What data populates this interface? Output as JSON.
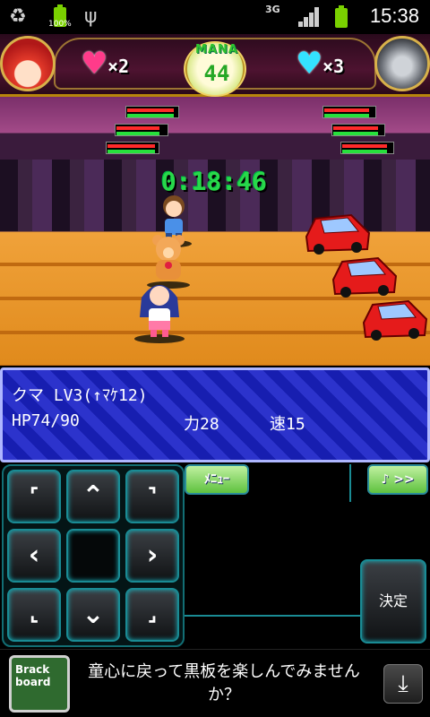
{
  "status_bar": {
    "battery_percent": "100%",
    "network": "3G",
    "time": "15:38",
    "icons": [
      "recycle-icon",
      "battery-charging-icon",
      "usb-icon",
      "network-3g-icon",
      "signal-icon",
      "battery-icon"
    ]
  },
  "hud": {
    "player_lives": "×2",
    "enemy_lives": "×3",
    "mana_label": "MANA",
    "mana_value": "44",
    "timer": "0:18:46",
    "colors": {
      "pink_heart": "#ff3b8a",
      "cyan_heart": "#34e2ff",
      "timer": "#28d84a"
    }
  },
  "gauges": [
    {
      "hp": 0.92,
      "mp": 0.92
    },
    {
      "hp": 0.85,
      "mp": 0.85
    },
    {
      "hp": 0.95,
      "mp": 0.95
    },
    {
      "hp": 0.9,
      "mp": 0.9
    },
    {
      "hp": 0.9,
      "mp": 0.9
    },
    {
      "hp": 0.9,
      "mp": 0.9
    }
  ],
  "info": {
    "name_level": "クマ LV3(↑ﾏｹ12)",
    "hp": "HP74/90",
    "power": "力28",
    "speed": "速15"
  },
  "controls": {
    "menu_label": "ﾒﾆｭｰ",
    "music_label": "♪ >>",
    "decide_label": "決定"
  },
  "ad": {
    "logo_text": "Brack board",
    "text": "童心に戻って黒板を楽しんでみませんか？"
  }
}
